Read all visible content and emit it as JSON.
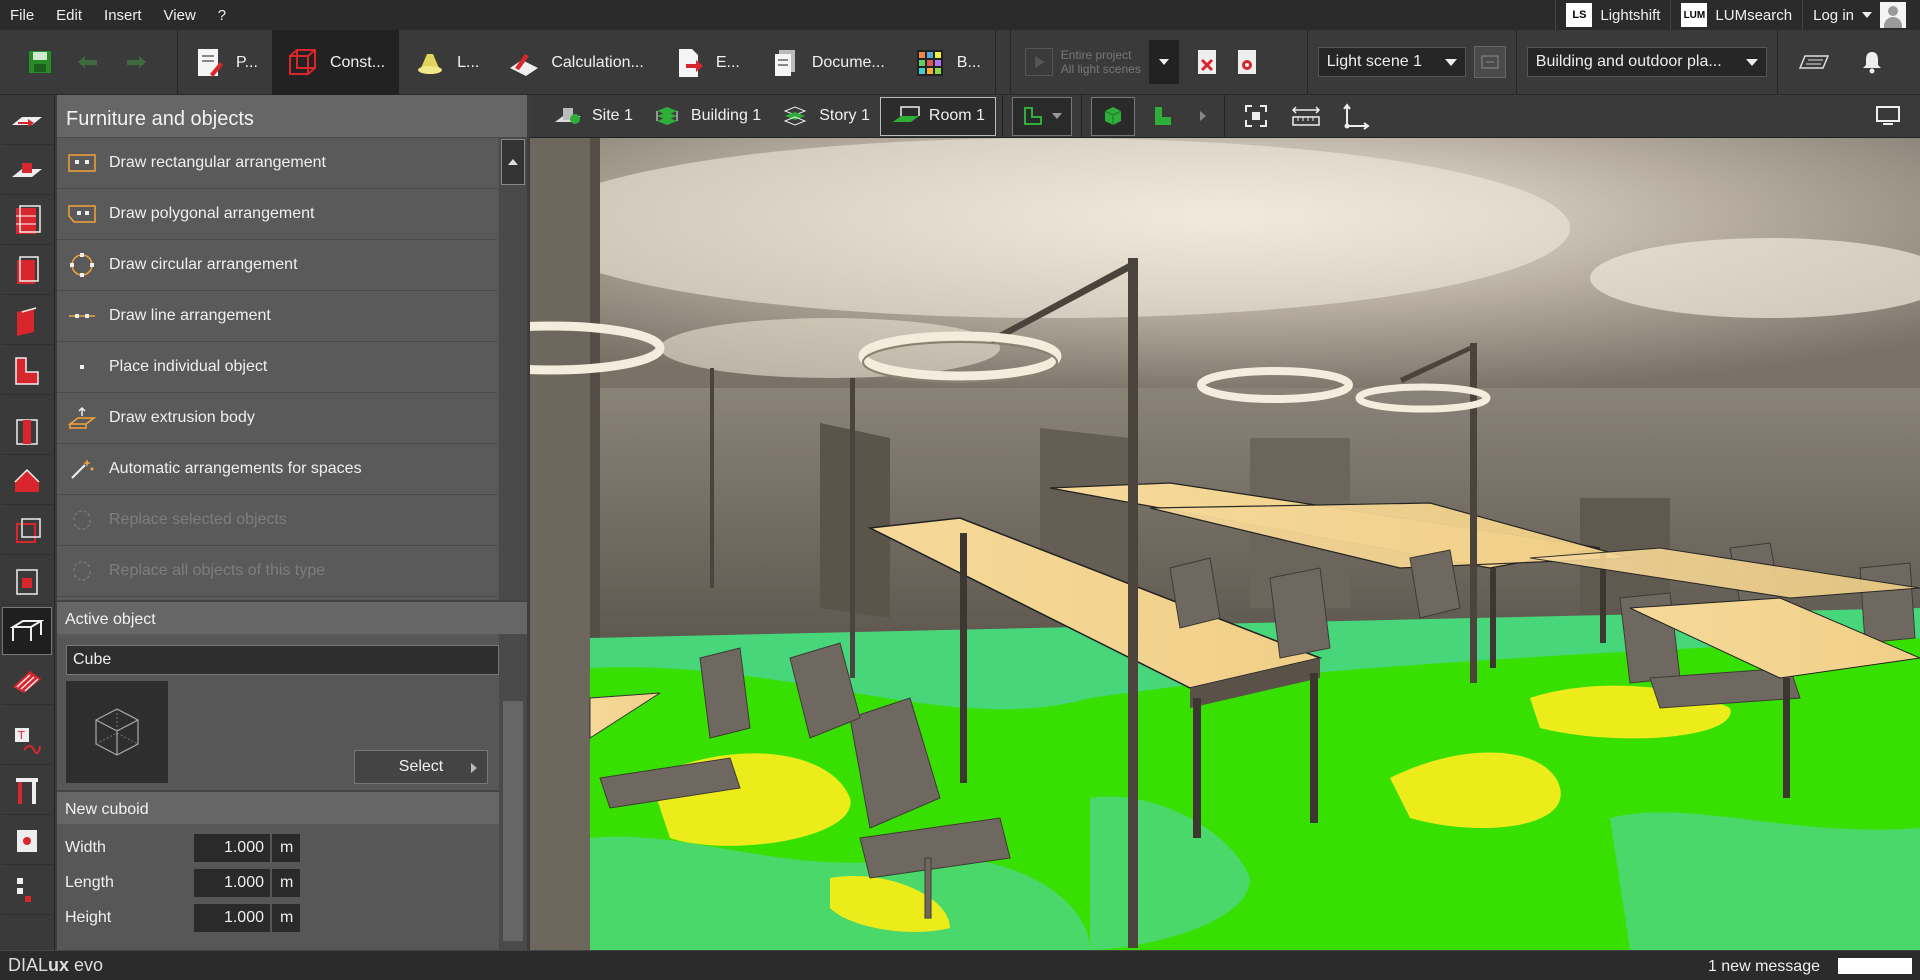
{
  "menu": {
    "items": [
      "File",
      "Edit",
      "Insert",
      "View",
      "?"
    ],
    "lightshift": "Lightshift",
    "lightshift_logo": "LS",
    "lumsearch": "LUMsearch",
    "lumsearch_logo": "LUM",
    "login": "Log in"
  },
  "toolbar": {
    "tabs": [
      {
        "label": "P...",
        "icon": "document-pen-icon"
      },
      {
        "label": "Const...",
        "icon": "cube-construction-icon"
      },
      {
        "label": "L...",
        "icon": "luminaire-icon"
      },
      {
        "label": "Calculation...",
        "icon": "calculation-plane-icon"
      },
      {
        "label": "E...",
        "icon": "export-icon"
      },
      {
        "label": "Docume...",
        "icon": "documentation-icon"
      },
      {
        "label": "B...",
        "icon": "color-grid-icon"
      }
    ],
    "project_line1": "Entire project",
    "project_line2": "All light scenes",
    "light_scene": "Light scene 1",
    "view_mode": "Building and outdoor pla..."
  },
  "panel": {
    "title": "Furniture and objects",
    "items": [
      {
        "label": "Draw rectangular arrangement",
        "icon": "rect-arrangement-icon",
        "enabled": true
      },
      {
        "label": "Draw polygonal arrangement",
        "icon": "polygon-arrangement-icon",
        "enabled": true
      },
      {
        "label": "Draw circular arrangement",
        "icon": "circular-arrangement-icon",
        "enabled": true
      },
      {
        "label": "Draw line arrangement",
        "icon": "line-arrangement-icon",
        "enabled": true
      },
      {
        "label": "Place individual object",
        "icon": "single-object-icon",
        "enabled": true
      },
      {
        "label": "Draw extrusion body",
        "icon": "extrusion-icon",
        "enabled": true
      },
      {
        "label": "Automatic arrangements for spaces",
        "icon": "magic-wand-icon",
        "enabled": true
      },
      {
        "label": "Replace selected objects",
        "icon": "replace-icon",
        "enabled": false
      },
      {
        "label": "Replace all objects of this type",
        "icon": "replace-all-icon",
        "enabled": false
      }
    ],
    "active_object_title": "Active object",
    "active_object_name": "Cube",
    "select_label": "Select",
    "new_cuboid_title": "New cuboid",
    "props": [
      {
        "label": "Width",
        "value": "1.000",
        "unit": "m"
      },
      {
        "label": "Length",
        "value": "1.000",
        "unit": "m"
      },
      {
        "label": "Height",
        "value": "1.000",
        "unit": "m"
      }
    ]
  },
  "viewport_toolbar": {
    "breadcrumbs": [
      "Site 1",
      "Building 1",
      "Story 1",
      "Room 1"
    ]
  },
  "status": {
    "brand_light": "DIAL",
    "brand_bold": "ux",
    "brand_suffix": " evo",
    "message": "1 new message"
  },
  "colors": {
    "accent_red": "#d9262c",
    "accent_green": "#2fae3a",
    "false_color_green": "#36e000",
    "false_color_yellow": "#ecec1a"
  }
}
